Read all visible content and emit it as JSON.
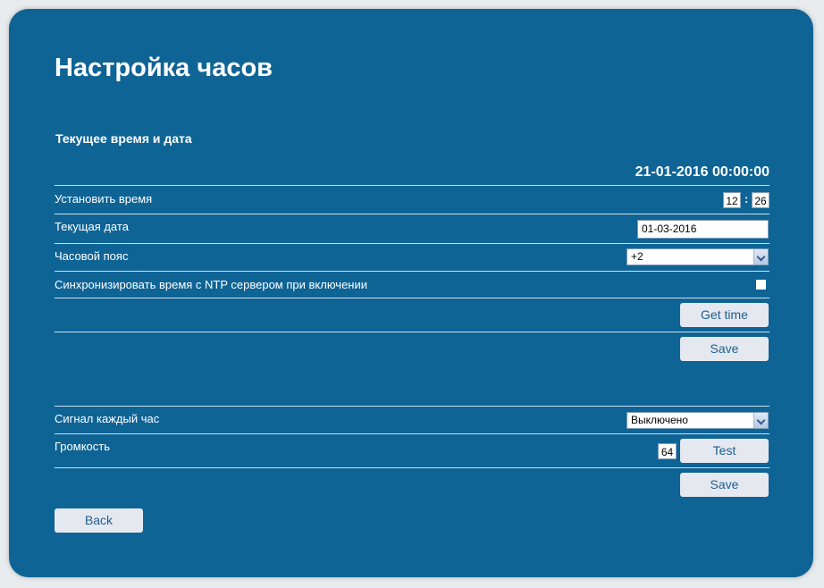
{
  "page": {
    "title": "Настройка часов"
  },
  "current": {
    "section_title": "Текущее время и дата",
    "datetime": "21-01-2016 00:00:00",
    "set_time_label": "Установить время",
    "hour": "12",
    "minute": "26",
    "time_separator": ":",
    "date_label": "Текущая дата",
    "date_value": "01-03-2016",
    "timezone_label": "Часовой пояс",
    "timezone_value": "+2",
    "ntp_label": "Синхронизировать время с NTP сервером при включении",
    "ntp_checked": false,
    "get_time_label": "Get time",
    "save_label": "Save"
  },
  "chime": {
    "hourly_label": "Сигнал каждый час",
    "hourly_value": "Выключено",
    "volume_label": "Громкость",
    "volume_value": "64",
    "test_label": "Test",
    "save_label": "Save"
  },
  "nav": {
    "back_label": "Back"
  },
  "colors": {
    "panel_background": "#0f6496",
    "button_background": "#e6e8ef",
    "button_text": "#1a5f93"
  }
}
